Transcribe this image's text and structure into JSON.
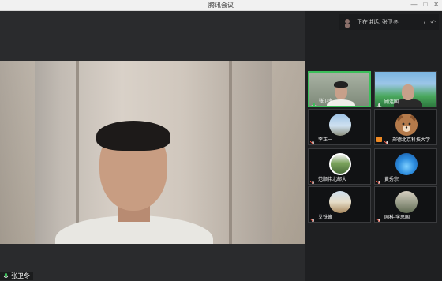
{
  "window": {
    "title": "腾讯会议"
  },
  "main": {
    "speaker_name": "张卫冬"
  },
  "sidebar": {
    "speaking_label": "正在讲话: 张卫冬",
    "participants": [
      {
        "name": "张卫冬",
        "tile": "video-speaker",
        "active": true
      },
      {
        "name": "顾连国",
        "tile": "video-outdoor",
        "active": false
      },
      {
        "name": "李正一",
        "tile": "avatar-sky",
        "active": false
      },
      {
        "name": "郑德北京科技大学",
        "tile": "avatar-bear",
        "active": false
      },
      {
        "name": "范顺伟北邮大",
        "tile": "avatar-group",
        "active": false
      },
      {
        "name": "黄秀宗",
        "tile": "avatar-blue",
        "active": false
      },
      {
        "name": "艾铁峰",
        "tile": "avatar-beach",
        "active": false
      },
      {
        "name": "网科-李思国",
        "tile": "avatar-landscape",
        "active": false
      }
    ]
  },
  "colors": {
    "active_border": "#3bbf5a",
    "background": "#2b2c2e"
  }
}
